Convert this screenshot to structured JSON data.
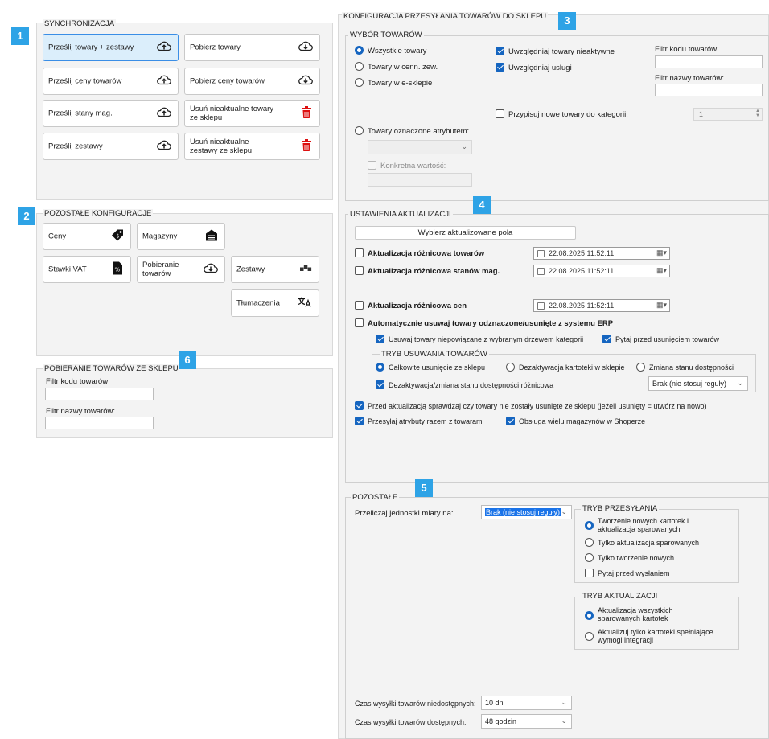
{
  "badges": {
    "b1": "1",
    "b2": "2",
    "b3": "3",
    "b4": "4",
    "b5": "5",
    "b6": "6"
  },
  "sync": {
    "title": "SYNCHRONIZACJA",
    "send_all": "Prześlij towary + zestawy",
    "get_goods": "Pobierz towary",
    "send_prices": "Prześlij ceny towarów",
    "get_prices": "Pobierz ceny towarów",
    "send_stock": "Prześlij stany mag.",
    "remove_goods": "Usuń nieaktualne towary ze sklepu",
    "send_sets": "Prześlij zestawy",
    "remove_sets": "Usuń nieaktualne zestawy ze sklepu"
  },
  "other_config": {
    "title": "POZOSTAŁE KONFIGURACJE",
    "prices": "Ceny",
    "warehouses": "Magazyny",
    "vat": "Stawki VAT",
    "fetch_goods": "Pobieranie towarów",
    "sets": "Zestawy",
    "translations": "Tłumaczenia"
  },
  "fetch_panel": {
    "title": "POBIERANIE TOWARÓW ZE SKLEPU",
    "code_filter": "Filtr kodu towarów:",
    "name_filter": "Filtr nazwy towarów:"
  },
  "main": {
    "title": "KONFIGURACJA PRZESYŁANIA TOWARÓW DO SKLEPU",
    "selection": {
      "title": "WYBÓR TOWARÓW",
      "all": "Wszystkie towary",
      "ext_price": "Towary w cenn. zew.",
      "eshop": "Towary w e-sklepie",
      "inactive": "Uwzględniaj towary nieaktywne",
      "services": "Uwzględniaj usługi",
      "code_filter": "Filtr kodu towarów:",
      "name_filter": "Filtr nazwy towarów:",
      "assign_cat": "Przypisuj nowe towary do kategorii:",
      "cat_value": "1",
      "attr": "Towary oznaczone atrybutem:",
      "specific": "Konkretna wartość:"
    },
    "update": {
      "title": "USTAWIENIA AKTUALIZACJI",
      "pick_fields": "Wybierz aktualizowane pola",
      "diff_goods": "Aktualizacja różnicowa towarów",
      "diff_stock": "Aktualizacja różnicowa stanów mag.",
      "diff_prices": "Aktualizacja różnicowa cen",
      "date1": "22.08.2025 11:52:11",
      "date2": "22.08.2025 11:52:11",
      "date3": "22.08.2025 11:52:11",
      "auto_remove": "Automatycznie usuwaj towary odznaczone/usunięte z systemu ERP",
      "remove_unlinked": "Usuwaj towary niepowiązane z wybranym drzewem kategorii",
      "ask_before": "Pytaj przed usunięciem towarów",
      "removal_mode": {
        "title": "TRYB USUWANIA TOWARÓW",
        "full": "Całkowite usunięcie ze sklepu",
        "deactivate": "Dezaktywacja kartoteki w sklepie",
        "change_avail": "Zmiana stanu dostępności",
        "diff_deact": "Dezaktywacja/zmiana stanu dostępności różnicowa",
        "rule": "Brak (nie stosuj reguły)"
      },
      "check_removed": "Przed aktualizacją sprawdzaj czy towary nie zostały usunięte ze sklepu (jeżeli usunięty = utwórz na nowo)",
      "send_attrs": "Przesyłaj atrybuty razem z towarami",
      "multi_wh": "Obsługa wielu magazynów w Shoperze"
    },
    "other": {
      "title": "POZOSTAŁE",
      "convert_units": "Przeliczaj jednostki miary na:",
      "units_value": "Brak (nie stosuj reguły)",
      "send_mode": {
        "title": "TRYB PRZESYŁANIA",
        "create_update": "Tworzenie nowych kartotek i aktualizacja sparowanych",
        "update_only": "Tylko aktualizacja sparowanych",
        "create_only": "Tylko tworzenie nowych",
        "ask": "Pytaj przed wysłaniem"
      },
      "update_mode": {
        "title": "TRYB AKTUALIZACJI",
        "all_paired": "Aktualizacja wszystkich sparowanych kartotek",
        "only_matching": "Aktualizuj tylko kartoteki spełniające wymogi integracji"
      },
      "unavail_time": "Czas wysyłki towarów niedostępnych:",
      "unavail_value": "10 dni",
      "avail_time": "Czas wysyłki towarów dostępnych:",
      "avail_value": "48 godzin"
    }
  }
}
